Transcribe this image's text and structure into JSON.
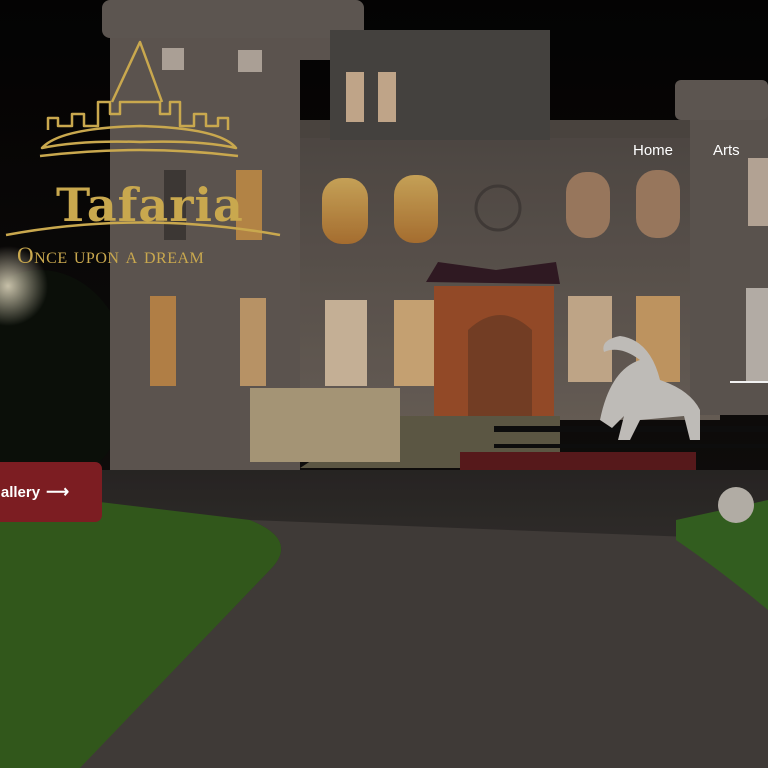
{
  "brand": {
    "name": "Tafaria",
    "tagline": "Once upon a dream",
    "gold": "#c9a84e"
  },
  "nav": {
    "items": [
      {
        "label": "Home"
      },
      {
        "label": "Arts"
      }
    ]
  },
  "hero": {
    "cta_label": "Gallery",
    "cta_icon": "arrow-right-icon",
    "cta_color": "#7c1d22"
  }
}
